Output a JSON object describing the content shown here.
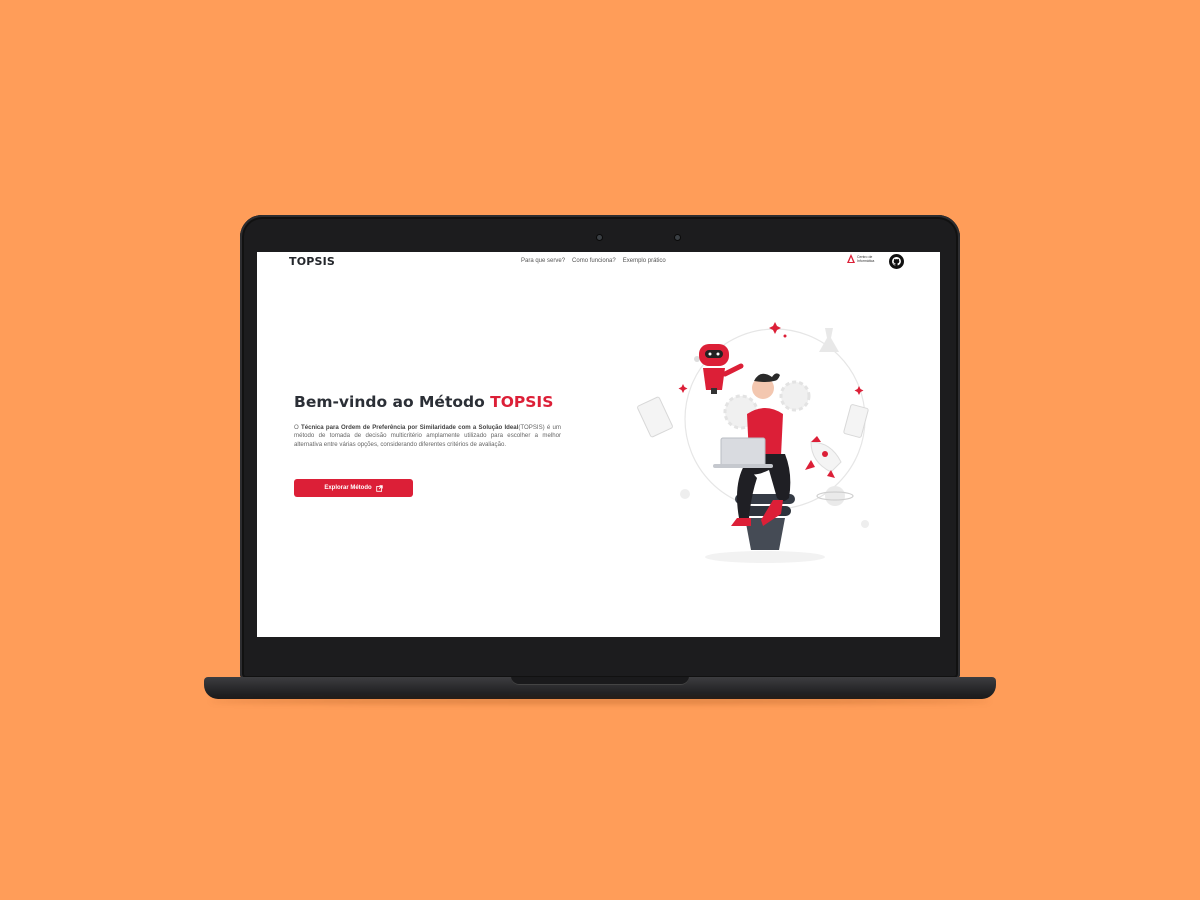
{
  "nav": {
    "logo": "TOPSIS",
    "links": [
      "Para que serve?",
      "Como funciona?",
      "Exemplo prático"
    ],
    "partner_label": "Centro de Informática"
  },
  "hero": {
    "title_main": "Bem-vindo ao Método ",
    "title_accent": "TOPSIS",
    "desc_prefix": "O ",
    "desc_bold": "Técnica para Ordem de Preferência por Similaridade com a Solução Ideal",
    "desc_suffix": "(TOPSIS) é um método de tomada de decisão multicritério amplamente utilizado para escolher a melhor alternativa entre várias opções, considerando diferentes critérios de avaliação.",
    "cta_label": "Explorar Método"
  },
  "colors": {
    "background": "#FF9D59",
    "accent": "#DC1F37",
    "text_dark": "#2b2f36"
  },
  "icons": {
    "github": "github-icon",
    "external_link": "external-link-icon",
    "partner_logo": "partner-logo-icon"
  }
}
